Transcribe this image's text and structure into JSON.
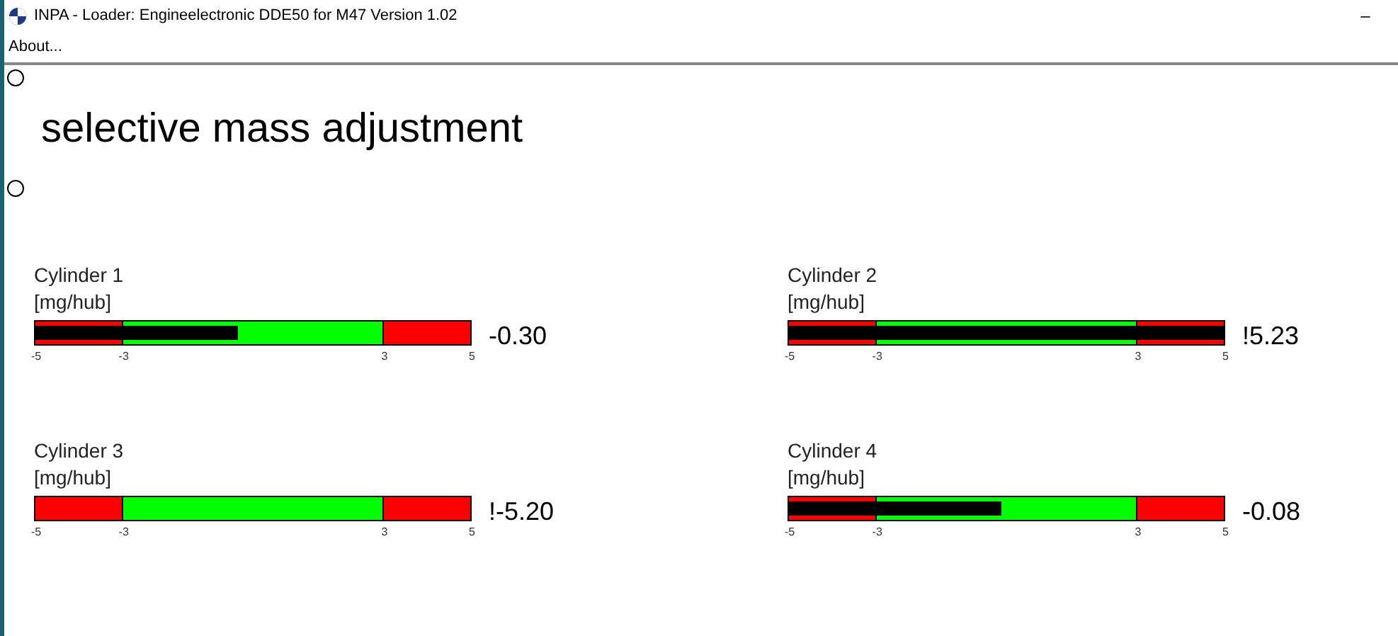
{
  "window": {
    "title": "INPA - Loader:  Engineelectronic DDE50 for M47 Version 1.02",
    "minimize": "–"
  },
  "menu": [
    "About..."
  ],
  "heading": "selective mass adjustment",
  "gauges": [
    {
      "label": "Cylinder 1",
      "unit": "[mg/hub]",
      "level": 0.466,
      "reading": "-0.30",
      "ticks": [
        "-5",
        "-3",
        "3",
        "5"
      ]
    },
    {
      "label": "Cylinder 2",
      "unit": "[mg/hub]",
      "level": 1.0,
      "reading": "!5.23",
      "ticks": [
        "-5",
        "-3",
        "3",
        "5"
      ]
    },
    {
      "label": "Cylinder 3",
      "unit": "[mg/hub]",
      "reading": "!-5.20",
      "ticks": [
        "-5",
        "-3",
        "3",
        "5"
      ]
    },
    {
      "label": "Cylinder 4",
      "unit": "[mg/hub]",
      "level": 0.49,
      "reading": "-0.08",
      "ticks": [
        "-5",
        "-3",
        "3",
        "5"
      ]
    }
  ]
}
